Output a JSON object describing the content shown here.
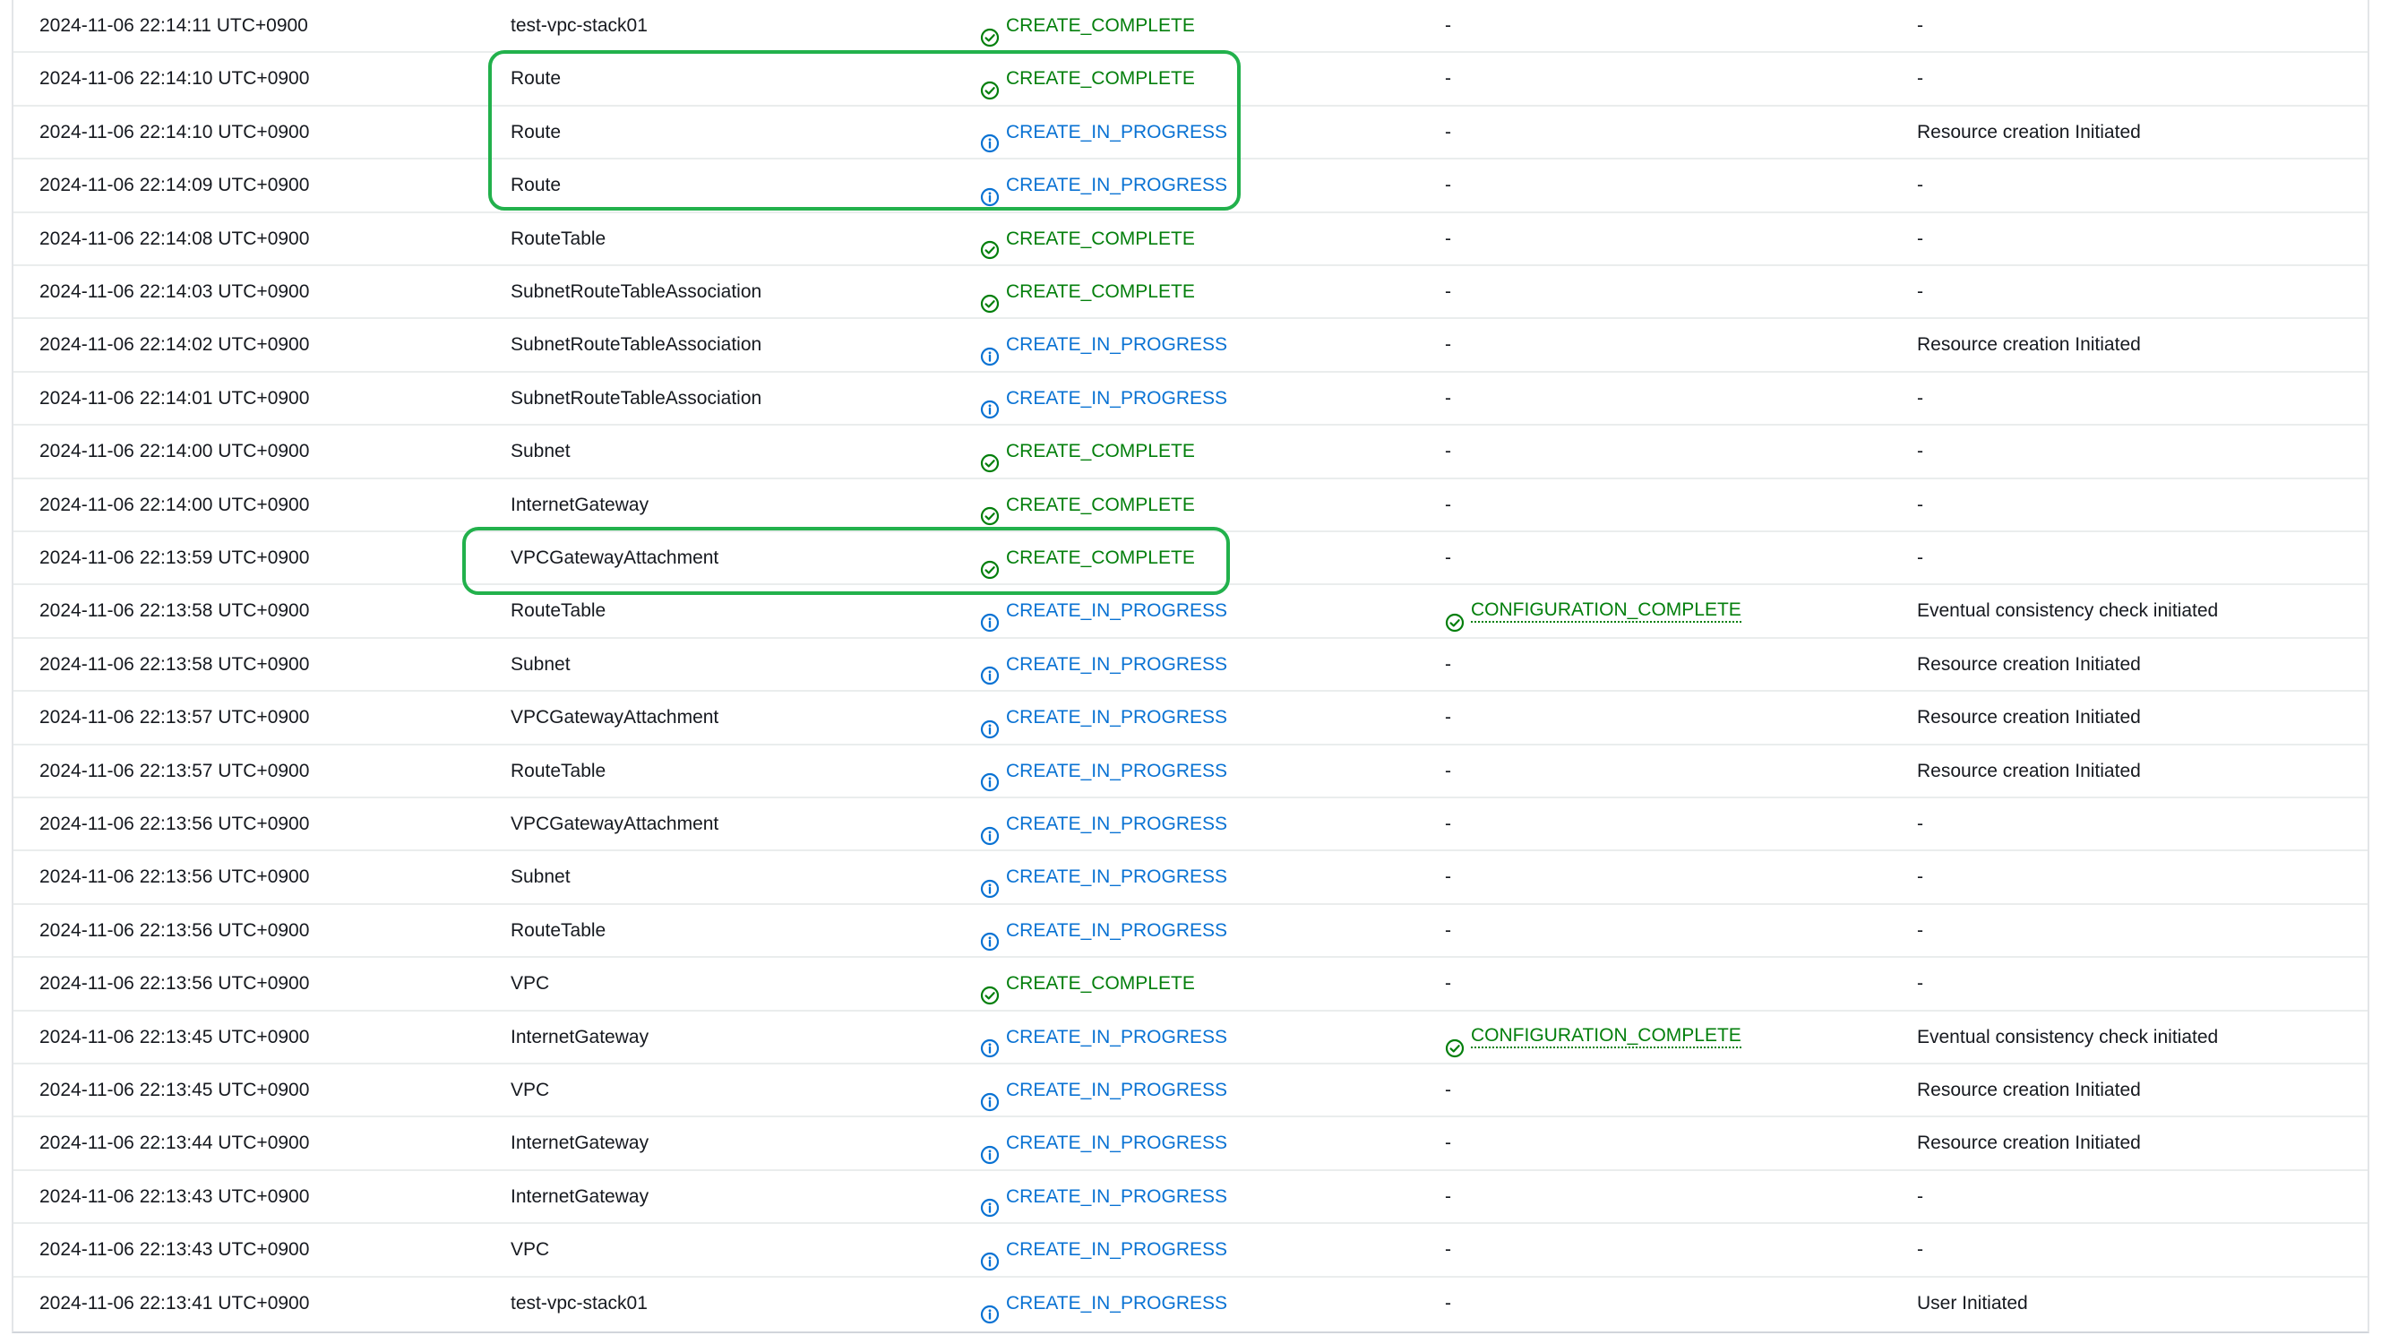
{
  "colors": {
    "complete": "#037f0c",
    "in_progress": "#0972d3",
    "highlight": "#22b14c"
  },
  "status_icons": {
    "complete": "check-circle-icon",
    "in_progress": "info-circle-icon"
  },
  "events": [
    {
      "timestamp": "2024-11-06 22:14:11 UTC+0900",
      "logical_id": "test-vpc-stack01",
      "status": "CREATE_COMPLETE",
      "status_kind": "complete",
      "detailed_status": "-",
      "reason": "-"
    },
    {
      "timestamp": "2024-11-06 22:14:10 UTC+0900",
      "logical_id": "Route",
      "status": "CREATE_COMPLETE",
      "status_kind": "complete",
      "detailed_status": "-",
      "reason": "-"
    },
    {
      "timestamp": "2024-11-06 22:14:10 UTC+0900",
      "logical_id": "Route",
      "status": "CREATE_IN_PROGRESS",
      "status_kind": "progress",
      "detailed_status": "-",
      "reason": "Resource creation Initiated"
    },
    {
      "timestamp": "2024-11-06 22:14:09 UTC+0900",
      "logical_id": "Route",
      "status": "CREATE_IN_PROGRESS",
      "status_kind": "progress",
      "detailed_status": "-",
      "reason": "-"
    },
    {
      "timestamp": "2024-11-06 22:14:08 UTC+0900",
      "logical_id": "RouteTable",
      "status": "CREATE_COMPLETE",
      "status_kind": "complete",
      "detailed_status": "-",
      "reason": "-"
    },
    {
      "timestamp": "2024-11-06 22:14:03 UTC+0900",
      "logical_id": "SubnetRouteTableAssociation",
      "status": "CREATE_COMPLETE",
      "status_kind": "complete",
      "detailed_status": "-",
      "reason": "-"
    },
    {
      "timestamp": "2024-11-06 22:14:02 UTC+0900",
      "logical_id": "SubnetRouteTableAssociation",
      "status": "CREATE_IN_PROGRESS",
      "status_kind": "progress",
      "detailed_status": "-",
      "reason": "Resource creation Initiated"
    },
    {
      "timestamp": "2024-11-06 22:14:01 UTC+0900",
      "logical_id": "SubnetRouteTableAssociation",
      "status": "CREATE_IN_PROGRESS",
      "status_kind": "progress",
      "detailed_status": "-",
      "reason": "-"
    },
    {
      "timestamp": "2024-11-06 22:14:00 UTC+0900",
      "logical_id": "Subnet",
      "status": "CREATE_COMPLETE",
      "status_kind": "complete",
      "detailed_status": "-",
      "reason": "-"
    },
    {
      "timestamp": "2024-11-06 22:14:00 UTC+0900",
      "logical_id": "InternetGateway",
      "status": "CREATE_COMPLETE",
      "status_kind": "complete",
      "detailed_status": "-",
      "reason": "-"
    },
    {
      "timestamp": "2024-11-06 22:13:59 UTC+0900",
      "logical_id": "VPCGatewayAttachment",
      "status": "CREATE_COMPLETE",
      "status_kind": "complete",
      "detailed_status": "-",
      "reason": "-"
    },
    {
      "timestamp": "2024-11-06 22:13:58 UTC+0900",
      "logical_id": "RouteTable",
      "status": "CREATE_IN_PROGRESS",
      "status_kind": "progress",
      "detailed_status": "CONFIGURATION_COMPLETE",
      "reason": "Eventual consistency check initiated"
    },
    {
      "timestamp": "2024-11-06 22:13:58 UTC+0900",
      "logical_id": "Subnet",
      "status": "CREATE_IN_PROGRESS",
      "status_kind": "progress",
      "detailed_status": "-",
      "reason": "Resource creation Initiated"
    },
    {
      "timestamp": "2024-11-06 22:13:57 UTC+0900",
      "logical_id": "VPCGatewayAttachment",
      "status": "CREATE_IN_PROGRESS",
      "status_kind": "progress",
      "detailed_status": "-",
      "reason": "Resource creation Initiated"
    },
    {
      "timestamp": "2024-11-06 22:13:57 UTC+0900",
      "logical_id": "RouteTable",
      "status": "CREATE_IN_PROGRESS",
      "status_kind": "progress",
      "detailed_status": "-",
      "reason": "Resource creation Initiated"
    },
    {
      "timestamp": "2024-11-06 22:13:56 UTC+0900",
      "logical_id": "VPCGatewayAttachment",
      "status": "CREATE_IN_PROGRESS",
      "status_kind": "progress",
      "detailed_status": "-",
      "reason": "-"
    },
    {
      "timestamp": "2024-11-06 22:13:56 UTC+0900",
      "logical_id": "Subnet",
      "status": "CREATE_IN_PROGRESS",
      "status_kind": "progress",
      "detailed_status": "-",
      "reason": "-"
    },
    {
      "timestamp": "2024-11-06 22:13:56 UTC+0900",
      "logical_id": "RouteTable",
      "status": "CREATE_IN_PROGRESS",
      "status_kind": "progress",
      "detailed_status": "-",
      "reason": "-"
    },
    {
      "timestamp": "2024-11-06 22:13:56 UTC+0900",
      "logical_id": "VPC",
      "status": "CREATE_COMPLETE",
      "status_kind": "complete",
      "detailed_status": "-",
      "reason": "-"
    },
    {
      "timestamp": "2024-11-06 22:13:45 UTC+0900",
      "logical_id": "InternetGateway",
      "status": "CREATE_IN_PROGRESS",
      "status_kind": "progress",
      "detailed_status": "CONFIGURATION_COMPLETE",
      "reason": "Eventual consistency check initiated"
    },
    {
      "timestamp": "2024-11-06 22:13:45 UTC+0900",
      "logical_id": "VPC",
      "status": "CREATE_IN_PROGRESS",
      "status_kind": "progress",
      "detailed_status": "-",
      "reason": "Resource creation Initiated"
    },
    {
      "timestamp": "2024-11-06 22:13:44 UTC+0900",
      "logical_id": "InternetGateway",
      "status": "CREATE_IN_PROGRESS",
      "status_kind": "progress",
      "detailed_status": "-",
      "reason": "Resource creation Initiated"
    },
    {
      "timestamp": "2024-11-06 22:13:43 UTC+0900",
      "logical_id": "InternetGateway",
      "status": "CREATE_IN_PROGRESS",
      "status_kind": "progress",
      "detailed_status": "-",
      "reason": "-"
    },
    {
      "timestamp": "2024-11-06 22:13:43 UTC+0900",
      "logical_id": "VPC",
      "status": "CREATE_IN_PROGRESS",
      "status_kind": "progress",
      "detailed_status": "-",
      "reason": "-"
    },
    {
      "timestamp": "2024-11-06 22:13:41 UTC+0900",
      "logical_id": "test-vpc-stack01",
      "status": "CREATE_IN_PROGRESS",
      "status_kind": "progress",
      "detailed_status": "-",
      "reason": "User Initiated"
    }
  ]
}
